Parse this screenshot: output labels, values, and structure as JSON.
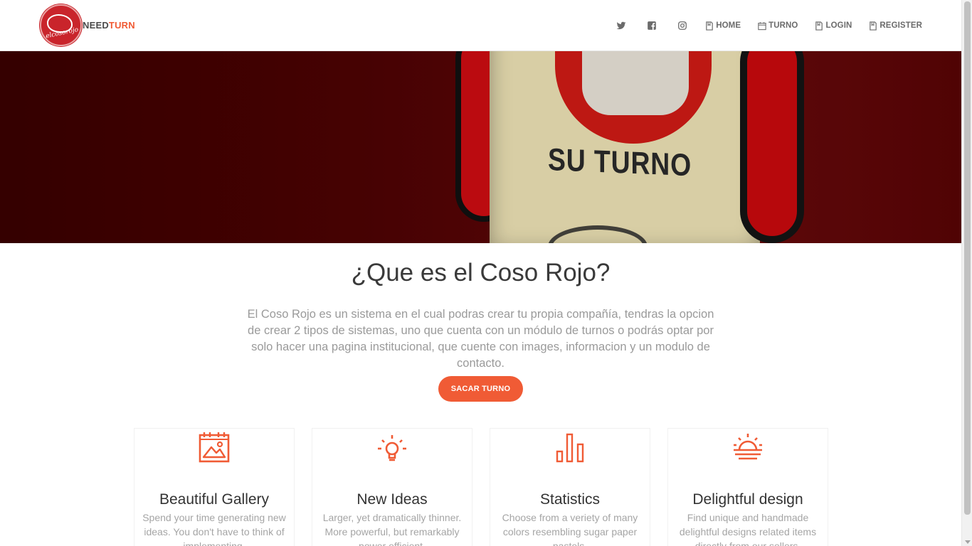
{
  "brand": {
    "logo_text": "elcosorojo",
    "name_part1": "NEED",
    "name_part2": "TURN"
  },
  "nav": {
    "social": [
      "twitter-icon",
      "facebook-icon",
      "instagram-icon"
    ],
    "links": [
      {
        "label": "HOME",
        "icon": "page-icon"
      },
      {
        "label": "TURNO",
        "icon": "calendar-icon"
      },
      {
        "label": "LOGIN",
        "icon": "page-icon"
      },
      {
        "label": "REGISTER",
        "icon": "page-icon"
      }
    ]
  },
  "hero": {
    "sign_text": "SU TURNO"
  },
  "about": {
    "title": "¿Que es el Coso Rojo?",
    "description": "El Coso Rojo es un sistema en el cual podras crear tu propia compañía, tendras la opcion de crear 2 tipos de sistemas, uno que cuenta con un módulo de turnos o podrás optar por solo hacer una pagina institucional, que cuente con images, informacion y un modulo de contacto.",
    "cta_label": "SACAR TURNO"
  },
  "features": [
    {
      "icon": "gallery-icon",
      "title": "Beautiful Gallery",
      "description": "Spend your time generating new ideas. You don't have to think of implementing."
    },
    {
      "icon": "lightbulb-icon",
      "title": "New Ideas",
      "description": "Larger, yet dramatically thinner. More powerful, but remarkably power efficient."
    },
    {
      "icon": "bar-chart-icon",
      "title": "Statistics",
      "description": "Choose from a veriety of many colors resembling sugar paper pastels."
    },
    {
      "icon": "sunrise-icon",
      "title": "Delightful design",
      "description": "Find unique and handmade delightful designs related items directly from our sellers."
    }
  ],
  "colors": {
    "accent": "#f05b35",
    "brand_red": "#c9242b",
    "text_dark": "#333333",
    "text_muted": "#9a9a9a"
  }
}
